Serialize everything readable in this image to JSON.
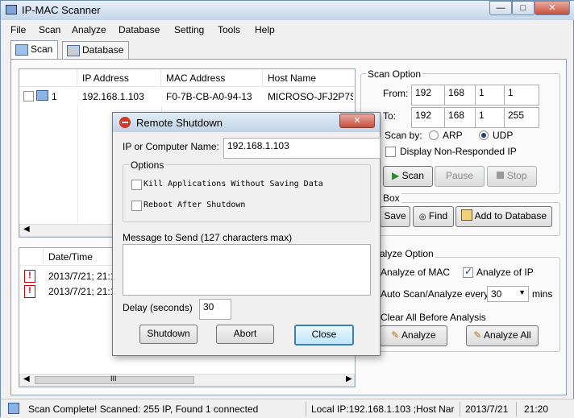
{
  "window": {
    "title": "IP-MAC Scanner",
    "controls": [
      "—",
      "□",
      "✕"
    ]
  },
  "menu": [
    "File",
    "Scan",
    "Analyze",
    "Database",
    "Setting",
    "Tools",
    "Help"
  ],
  "tabs": {
    "scan": "Scan",
    "database": "Database"
  },
  "scan_table": {
    "headers": [
      "IP Address",
      "MAC Address",
      "Host Name"
    ],
    "row": {
      "index": "1",
      "ip": "192.168.1.103",
      "mac": "F0-7B-CB-A0-94-13",
      "host": "MICROSO-JFJ2P7S"
    }
  },
  "log_table": {
    "header": "Date/Time",
    "rows": [
      "2013/7/21; 21:1",
      "2013/7/21; 21:1"
    ],
    "scroll_grip": "III"
  },
  "scan_option": {
    "title": "Scan Option",
    "from_label": "From:",
    "from": [
      "192",
      "168",
      "1",
      "1"
    ],
    "to_label": "To:",
    "to": [
      "192",
      "168",
      "1",
      "255"
    ],
    "scan_by_label": "Scan by:",
    "arp": "ARP",
    "udp": "UDP",
    "display_non_responded": "Display Non-Responded IP",
    "scan_btn": "Scan",
    "pause_btn": "Pause",
    "stop_btn": "Stop"
  },
  "box_group": {
    "title": "l Box",
    "save_btn": "Save",
    "find_btn": "Find",
    "add_db_btn": "Add to Database"
  },
  "analyze_option": {
    "title": "alyze Option",
    "analyze_mac": "Analyze of MAC",
    "analyze_ip": "Analyze of IP",
    "auto_scan": "Auto Scan/Analyze every",
    "interval": "30",
    "mins": "mins",
    "clear_all": "Clear All Before Analysis",
    "analyze_btn": "Analyze",
    "analyze_all_btn": "Analyze All"
  },
  "dialog": {
    "title": "Remote Shutdown",
    "ip_label": "IP or Computer Name:",
    "ip_value": "192.168.1.103",
    "options_title": "Options",
    "kill_apps": "Kill Applications Without Saving Data",
    "reboot": "Reboot After Shutdown",
    "message_label": "Message to Send (127 characters max)",
    "message_value": "",
    "delay_label": "Delay (seconds)",
    "delay_value": "30",
    "shutdown_btn": "Shutdown",
    "abort_btn": "Abort",
    "close_btn": "Close",
    "close_x": "✕"
  },
  "status": {
    "message": "Scan Complete! Scanned: 255 IP, Found 1 connected",
    "local_ip": "Local IP:192.168.1.103 ;Host Nar",
    "date": "2013/7/21",
    "time": "21:20"
  },
  "colors": {
    "accent": "#1a3f7a",
    "close_red": "#c7503d",
    "warn_red": "#cc0000"
  },
  "icons": [
    "app-icon",
    "scan-tab-icon",
    "database-tab-icon",
    "computer-icon",
    "warning-icon",
    "play-icon",
    "stop-icon",
    "save-icon",
    "binoculars-icon",
    "add-database-icon",
    "analyze-icon",
    "analyze-all-icon",
    "shutdown-icon"
  ]
}
